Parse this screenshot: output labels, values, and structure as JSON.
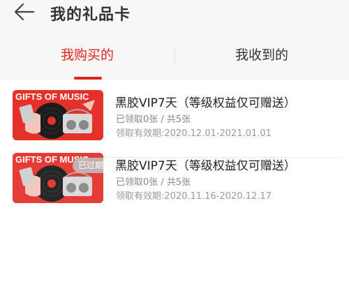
{
  "header": {
    "back_icon": "arrow-left-icon",
    "title": "我的礼品卡"
  },
  "tabs": [
    {
      "label": "我购买的",
      "active": true
    },
    {
      "label": "我收到的",
      "active": false
    }
  ],
  "colors": {
    "accent": "#e2231a",
    "card_bg": "#e4322b"
  },
  "cards": [
    {
      "thumbnail_text": "GIFTS OF MUSIC",
      "title": "黑胶VIP7天（等级权益仅可赠送）",
      "count": "已领取0张 / 共5张",
      "validity": "领取有效期:2020.12.01-2021.01.01",
      "expired": false
    },
    {
      "thumbnail_text": "GIFTS OF MUSIC",
      "title": "黑胶VIP7天（等级权益仅可赠送）",
      "count": "已领取0张 / 共5张",
      "validity": "领取有效期:2020.11.16-2020.12.17",
      "expired": true,
      "expired_label": "已过期"
    }
  ]
}
